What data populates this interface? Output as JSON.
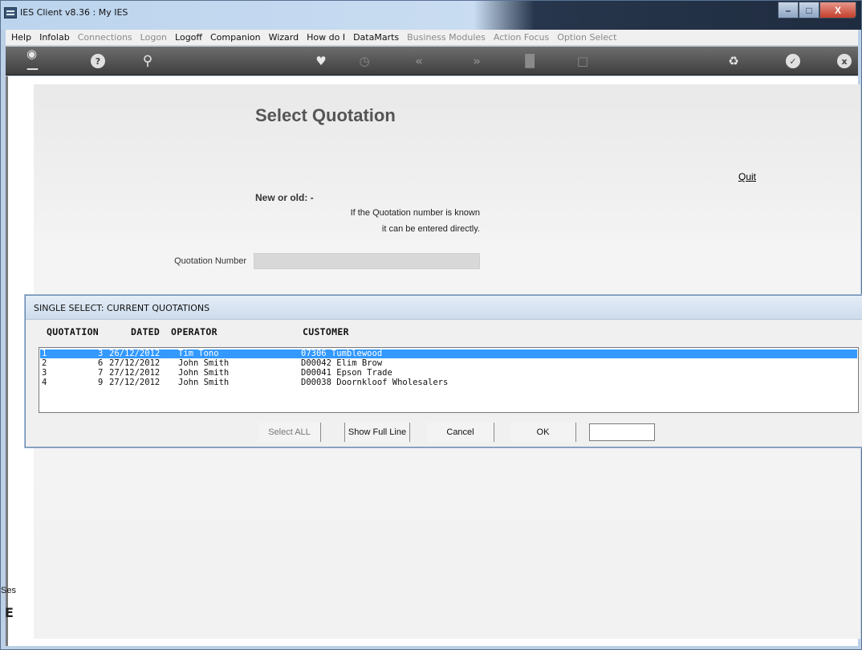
{
  "window": {
    "title": "IES Client v8.36 : My IES",
    "controls": {
      "minimize": "–",
      "maximize": "□",
      "close": "X"
    }
  },
  "menubar": {
    "items": [
      {
        "label": "Help",
        "enabled": true
      },
      {
        "label": "Infolab",
        "enabled": true
      },
      {
        "label": "Connections",
        "enabled": false
      },
      {
        "label": "Logon",
        "enabled": false
      },
      {
        "label": "Logoff",
        "enabled": true
      },
      {
        "label": "Companion",
        "enabled": true
      },
      {
        "label": "Wizard",
        "enabled": true
      },
      {
        "label": "How do I",
        "enabled": true
      },
      {
        "label": "DataMarts",
        "enabled": true
      },
      {
        "label": "Business Modules",
        "enabled": false
      },
      {
        "label": "Action Focus",
        "enabled": false
      },
      {
        "label": "Option Select",
        "enabled": false
      }
    ]
  },
  "toolbar": {
    "icons": [
      "key-icon",
      "help-icon",
      "search-icon",
      "heart-icon",
      "clock-icon",
      "back-icon",
      "forward-icon",
      "tools-icon",
      "page-icon",
      "recycle-icon",
      "check-icon",
      "close-icon"
    ]
  },
  "form": {
    "heading": "Select Quotation",
    "quit": "Quit",
    "new_or_old": "New or old: -",
    "hint_line1": "If the Quotation number is known",
    "hint_line2": "it can be entered directly.",
    "quotation_label": "Quotation Number",
    "quotation_value": ""
  },
  "dialog": {
    "title": "SINGLE SELECT: CURRENT QUOTATIONS",
    "columns": {
      "quotation": "QUOTATION",
      "dated": "DATED",
      "operator": "OPERATOR",
      "customer": "CUSTOMER"
    },
    "rows": [
      {
        "idx": "1",
        "quotation": "3",
        "dated": "26/12/2012",
        "operator": "Tim Tono",
        "customer": "07306 Tumblewood",
        "selected": true
      },
      {
        "idx": "2",
        "quotation": "6",
        "dated": "27/12/2012",
        "operator": "John Smith",
        "customer": "D00042 Elim Brow",
        "selected": false
      },
      {
        "idx": "3",
        "quotation": "7",
        "dated": "27/12/2012",
        "operator": "John Smith",
        "customer": "D00041 Epson Trade",
        "selected": false
      },
      {
        "idx": "4",
        "quotation": "9",
        "dated": "27/12/2012",
        "operator": "John Smith",
        "customer": "D00038 Doornkloof Wholesalers",
        "selected": false
      }
    ],
    "buttons": {
      "select_all": "Select ALL",
      "show_full_line": "Show Full Line",
      "cancel": "Cancel",
      "ok": "OK"
    },
    "filter_value": ""
  },
  "session": {
    "label": "Ses",
    "glyph": "E"
  },
  "colors": {
    "selection": "#3399ff",
    "toolbar": "#4e4e4e",
    "heading": "#555555"
  }
}
